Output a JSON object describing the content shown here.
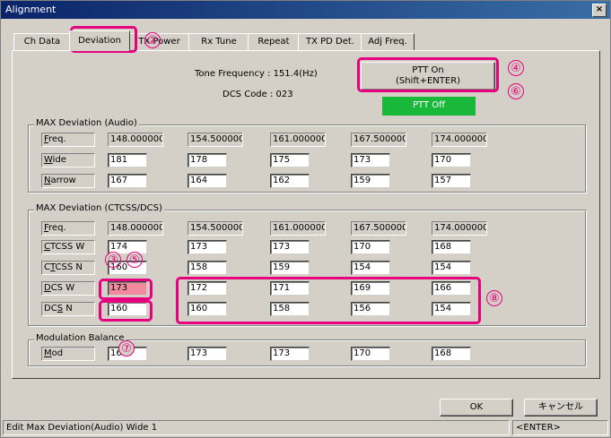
{
  "window": {
    "title": "Alignment",
    "close_glyph": "×"
  },
  "tabs": [
    {
      "label": "Ch Data"
    },
    {
      "label": "Deviation"
    },
    {
      "label": "TX Power"
    },
    {
      "label": "Rx Tune"
    },
    {
      "label": "Repeat"
    },
    {
      "label": "TX PD Det."
    },
    {
      "label": "Adj Freq."
    }
  ],
  "info": {
    "tone_frequency": "Tone Frequency : 151.4(Hz)",
    "dcs_code": "DCS Code : 023"
  },
  "ptt": {
    "button_line1": "PTT On",
    "button_line2": "(Shift+ENTER)",
    "status": "PTT Off",
    "status_color": "#1ab83a"
  },
  "audio": {
    "title": "MAX Deviation (Audio)",
    "freq_label": "Freq.",
    "freqs": [
      "148.000000",
      "154.500000",
      "161.000000",
      "167.500000",
      "174.000000"
    ],
    "rows": [
      {
        "label": "Wide",
        "values": [
          "181",
          "178",
          "175",
          "173",
          "170"
        ]
      },
      {
        "label": "Narrow",
        "values": [
          "167",
          "164",
          "162",
          "159",
          "157"
        ]
      }
    ]
  },
  "ctcss": {
    "title": "MAX Deviation (CTCSS/DCS)",
    "freq_label": "Freq.",
    "freqs": [
      "148.000000",
      "154.500000",
      "161.000000",
      "167.500000",
      "174.000000"
    ],
    "rows": [
      {
        "label": "CTCSS W",
        "values": [
          "174",
          "173",
          "173",
          "170",
          "168"
        ]
      },
      {
        "label": "CTCSS N",
        "values": [
          "160",
          "158",
          "159",
          "154",
          "154"
        ]
      },
      {
        "label": "DCS W",
        "values": [
          "173",
          "172",
          "171",
          "169",
          "166"
        ]
      },
      {
        "label": "DCS N",
        "values": [
          "160",
          "160",
          "158",
          "156",
          "154"
        ]
      }
    ]
  },
  "modulation": {
    "title": "Modulation Balance",
    "rows": [
      {
        "label": "Mod",
        "values": [
          "169",
          "173",
          "173",
          "170",
          "168"
        ]
      }
    ]
  },
  "buttons": {
    "ok": "OK",
    "cancel": "キャンセル"
  },
  "status": {
    "message": "Edit Max Deviation(Audio) Wide 1",
    "key": "<ENTER>"
  },
  "callouts": [
    "②",
    "③",
    "④",
    "⑤",
    "⑥",
    "⑦",
    "⑧"
  ],
  "highlight_color": "#e6007e",
  "selected_cell_color": "#f08a9c"
}
